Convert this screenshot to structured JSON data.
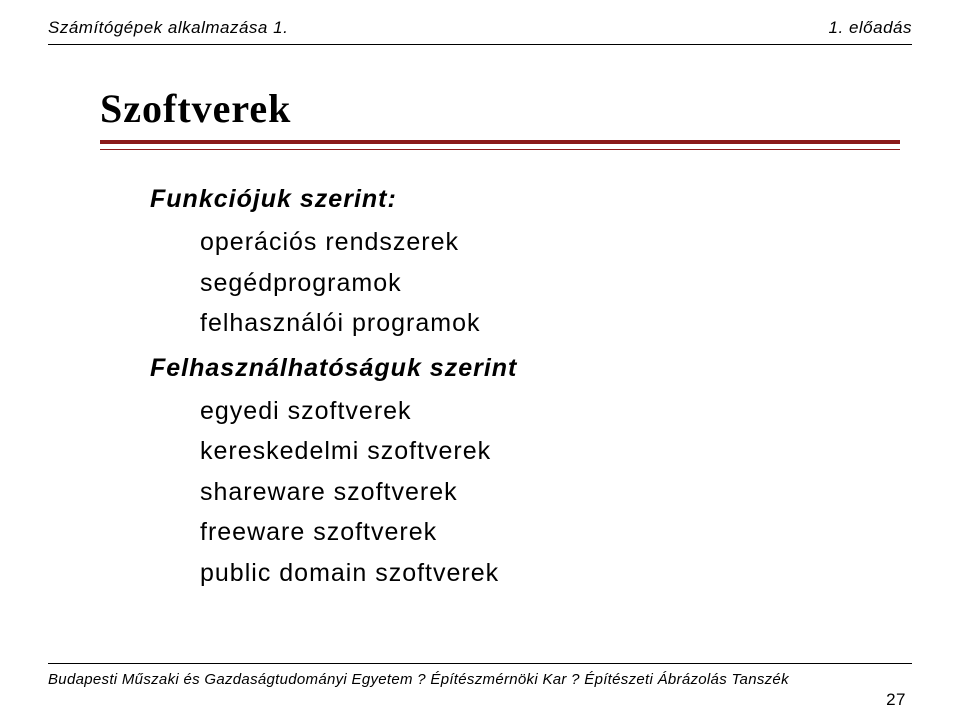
{
  "header": {
    "left": "Számítógépek alkalmazása 1.",
    "right": "1. előadás"
  },
  "title": "Szoftverek",
  "sections": {
    "funkciojuk": {
      "heading": "Funkciójuk szerint:",
      "items": [
        "operációs rendszerek",
        "segédprogramok",
        "felhasználói programok"
      ]
    },
    "felhasznalhatosaguk": {
      "heading": "Felhasználhatóságuk szerint",
      "items": [
        "egyedi szoftverek",
        "kereskedelmi szoftverek",
        "shareware szoftverek",
        "freeware szoftverek",
        "public domain szoftverek"
      ]
    }
  },
  "footer": "Budapesti Műszaki és Gazdaságtudományi Egyetem ? Építészmérnöki Kar ? Építészeti Ábrázolás Tanszék",
  "page_number": "27"
}
